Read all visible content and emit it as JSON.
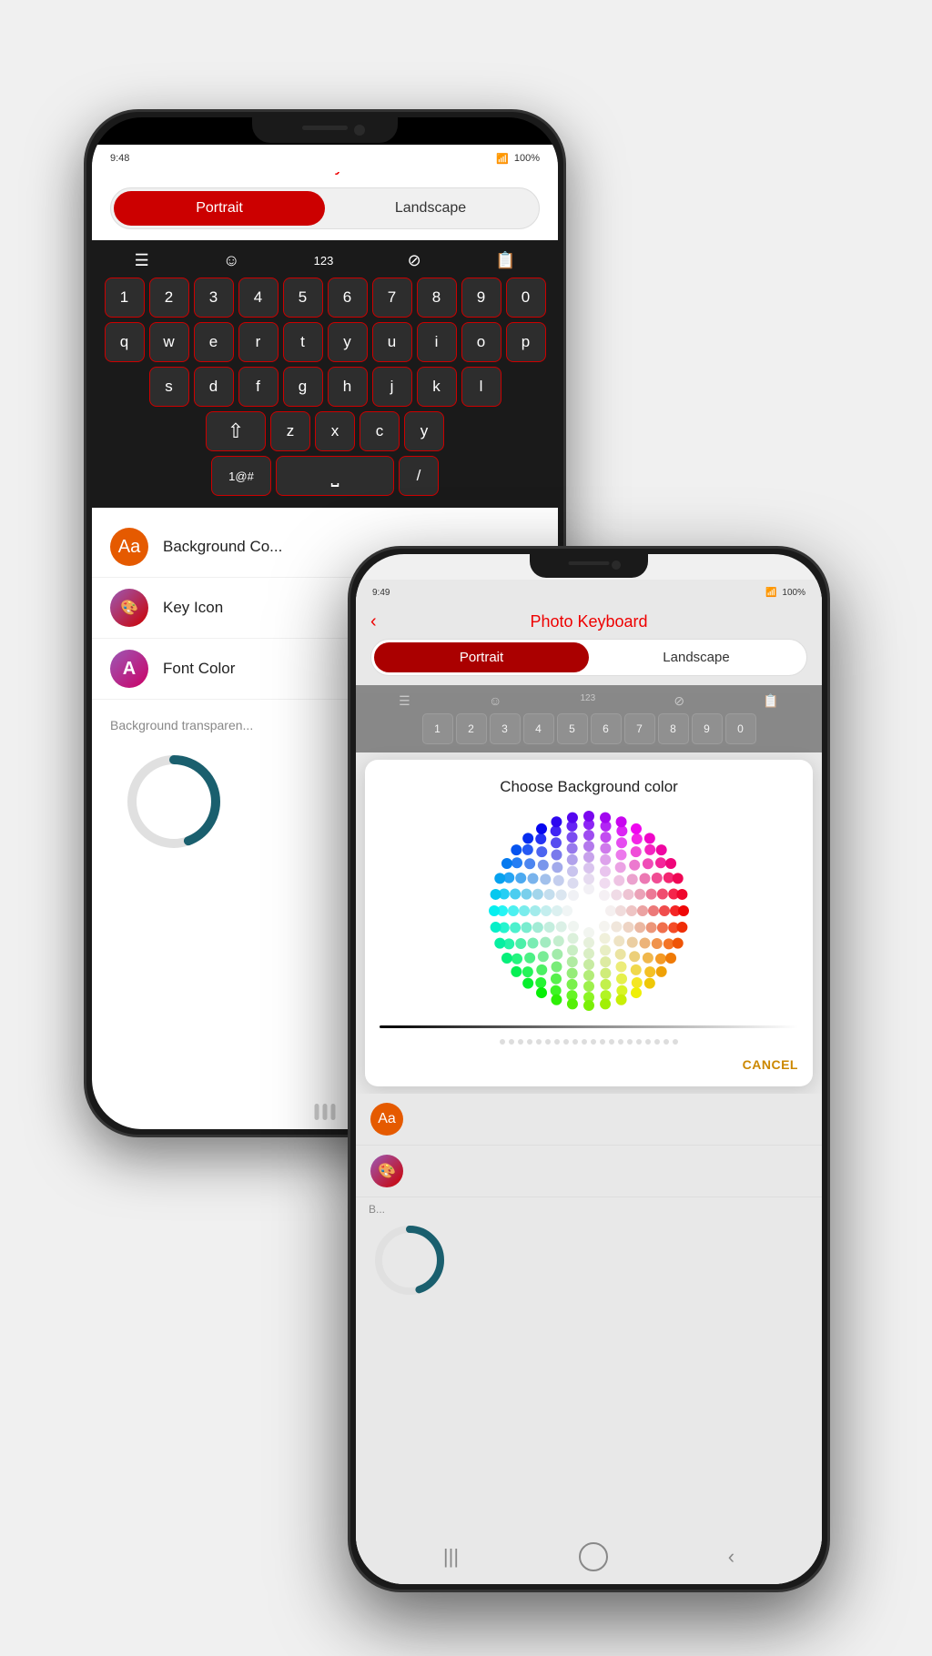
{
  "phone1": {
    "status_time": "9:48",
    "status_battery": "100%",
    "nav": {
      "back_label": "‹",
      "title": "Photo Keyboard"
    },
    "toggle": {
      "portrait_label": "Portrait",
      "landscape_label": "Landscape"
    },
    "keyboard": {
      "row1": [
        "1",
        "2",
        "3",
        "4",
        "5",
        "6",
        "7",
        "8",
        "9",
        "0"
      ],
      "row2": [
        "q",
        "w",
        "e",
        "r",
        "t",
        "y",
        "u",
        "i",
        "o",
        "p"
      ],
      "row3": [
        "s",
        "d",
        "f",
        "g",
        "h",
        "j",
        "k",
        "l"
      ],
      "row4": [
        "z",
        "x",
        "c",
        "y"
      ],
      "special_left": "1@#",
      "special_slash": "/"
    },
    "options": [
      {
        "label": "Background Co...",
        "icon_text": "Aa",
        "icon_color": "#e55a00"
      },
      {
        "label": "Key Icon",
        "icon_text": "🎨",
        "icon_color": "#9b3dcf"
      },
      {
        "label": "Font Color",
        "icon_text": "A",
        "icon_color": "#8833cc"
      }
    ],
    "section_label": "Background transparen...",
    "home_bars": [
      "",
      "",
      ""
    ]
  },
  "phone2": {
    "status_time": "9:49",
    "status_battery": "100%",
    "nav": {
      "back_label": "‹",
      "title": "Photo Keyboard"
    },
    "toggle": {
      "portrait_label": "Portrait",
      "landscape_label": "Landscape"
    },
    "dialog": {
      "title": "Choose Background color",
      "cancel_label": "CANCEL"
    },
    "options": [
      {
        "icon_color": "#e55a00"
      },
      {
        "icon_color": "#9b3dcf"
      }
    ],
    "bottom_nav": {
      "bars": "|||",
      "home": "○",
      "back": "‹"
    }
  }
}
